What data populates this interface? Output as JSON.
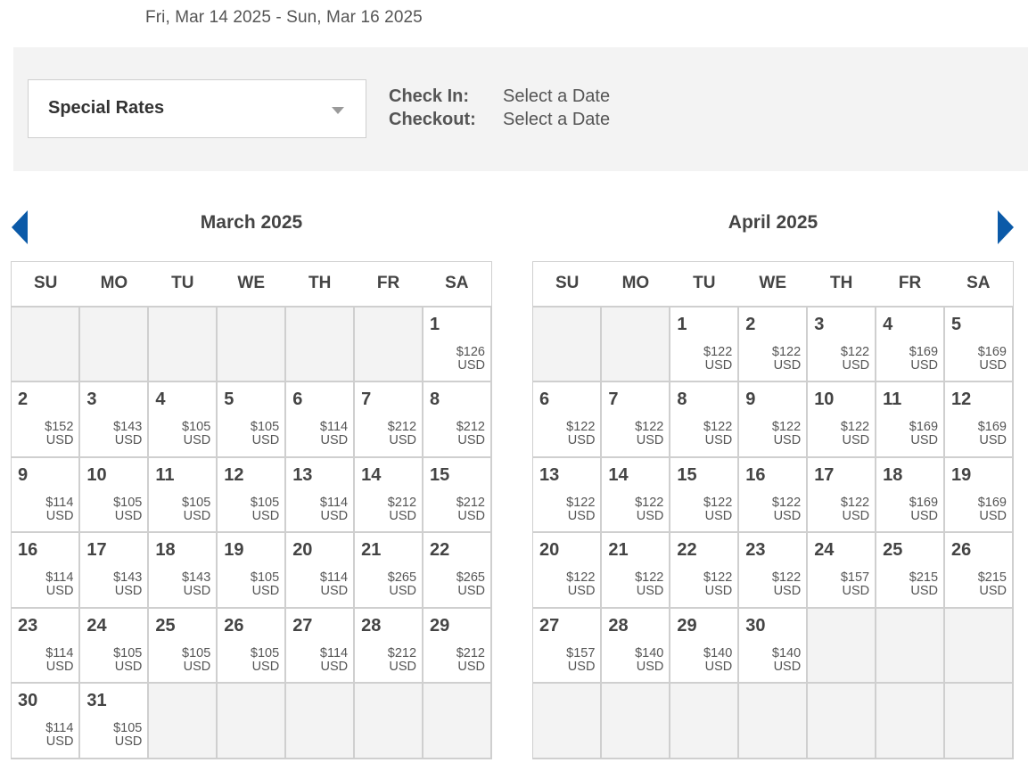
{
  "header": {
    "date_range": "Fri, Mar 14 2025 - Sun, Mar 16 2025"
  },
  "filter": {
    "rate_select": {
      "selected": "Special Rates"
    },
    "check_in_label": "Check In:",
    "check_in_value": "Select a Date",
    "checkout_label": "Checkout:",
    "checkout_value": "Select a Date"
  },
  "nav": {
    "prev_icon": "triangle-left-icon",
    "next_icon": "triangle-right-icon",
    "color": "#0b5aa8"
  },
  "weekdays": [
    "SU",
    "MO",
    "TU",
    "WE",
    "TH",
    "FR",
    "SA"
  ],
  "currency": "USD",
  "months": [
    {
      "title": "March 2025",
      "weeks": [
        [
          null,
          null,
          null,
          null,
          null,
          null,
          {
            "day": "1",
            "price": "$126"
          }
        ],
        [
          {
            "day": "2",
            "price": "$152"
          },
          {
            "day": "3",
            "price": "$143"
          },
          {
            "day": "4",
            "price": "$105"
          },
          {
            "day": "5",
            "price": "$105"
          },
          {
            "day": "6",
            "price": "$114"
          },
          {
            "day": "7",
            "price": "$212"
          },
          {
            "day": "8",
            "price": "$212"
          }
        ],
        [
          {
            "day": "9",
            "price": "$114"
          },
          {
            "day": "10",
            "price": "$105"
          },
          {
            "day": "11",
            "price": "$105"
          },
          {
            "day": "12",
            "price": "$105"
          },
          {
            "day": "13",
            "price": "$114"
          },
          {
            "day": "14",
            "price": "$212"
          },
          {
            "day": "15",
            "price": "$212"
          }
        ],
        [
          {
            "day": "16",
            "price": "$114"
          },
          {
            "day": "17",
            "price": "$143"
          },
          {
            "day": "18",
            "price": "$143"
          },
          {
            "day": "19",
            "price": "$105"
          },
          {
            "day": "20",
            "price": "$114"
          },
          {
            "day": "21",
            "price": "$265"
          },
          {
            "day": "22",
            "price": "$265"
          }
        ],
        [
          {
            "day": "23",
            "price": "$114"
          },
          {
            "day": "24",
            "price": "$105"
          },
          {
            "day": "25",
            "price": "$105"
          },
          {
            "day": "26",
            "price": "$105"
          },
          {
            "day": "27",
            "price": "$114"
          },
          {
            "day": "28",
            "price": "$212"
          },
          {
            "day": "29",
            "price": "$212"
          }
        ],
        [
          {
            "day": "30",
            "price": "$114"
          },
          {
            "day": "31",
            "price": "$105"
          },
          null,
          null,
          null,
          null,
          null
        ]
      ]
    },
    {
      "title": "April 2025",
      "weeks": [
        [
          null,
          null,
          {
            "day": "1",
            "price": "$122"
          },
          {
            "day": "2",
            "price": "$122"
          },
          {
            "day": "3",
            "price": "$122"
          },
          {
            "day": "4",
            "price": "$169"
          },
          {
            "day": "5",
            "price": "$169"
          }
        ],
        [
          {
            "day": "6",
            "price": "$122"
          },
          {
            "day": "7",
            "price": "$122"
          },
          {
            "day": "8",
            "price": "$122"
          },
          {
            "day": "9",
            "price": "$122"
          },
          {
            "day": "10",
            "price": "$122"
          },
          {
            "day": "11",
            "price": "$169"
          },
          {
            "day": "12",
            "price": "$169"
          }
        ],
        [
          {
            "day": "13",
            "price": "$122"
          },
          {
            "day": "14",
            "price": "$122"
          },
          {
            "day": "15",
            "price": "$122"
          },
          {
            "day": "16",
            "price": "$122"
          },
          {
            "day": "17",
            "price": "$122"
          },
          {
            "day": "18",
            "price": "$169"
          },
          {
            "day": "19",
            "price": "$169"
          }
        ],
        [
          {
            "day": "20",
            "price": "$122"
          },
          {
            "day": "21",
            "price": "$122"
          },
          {
            "day": "22",
            "price": "$122"
          },
          {
            "day": "23",
            "price": "$122"
          },
          {
            "day": "24",
            "price": "$157"
          },
          {
            "day": "25",
            "price": "$215"
          },
          {
            "day": "26",
            "price": "$215"
          }
        ],
        [
          {
            "day": "27",
            "price": "$157"
          },
          {
            "day": "28",
            "price": "$140"
          },
          {
            "day": "29",
            "price": "$140"
          },
          {
            "day": "30",
            "price": "$140"
          },
          null,
          null,
          null
        ],
        [
          null,
          null,
          null,
          null,
          null,
          null,
          null
        ]
      ]
    }
  ]
}
